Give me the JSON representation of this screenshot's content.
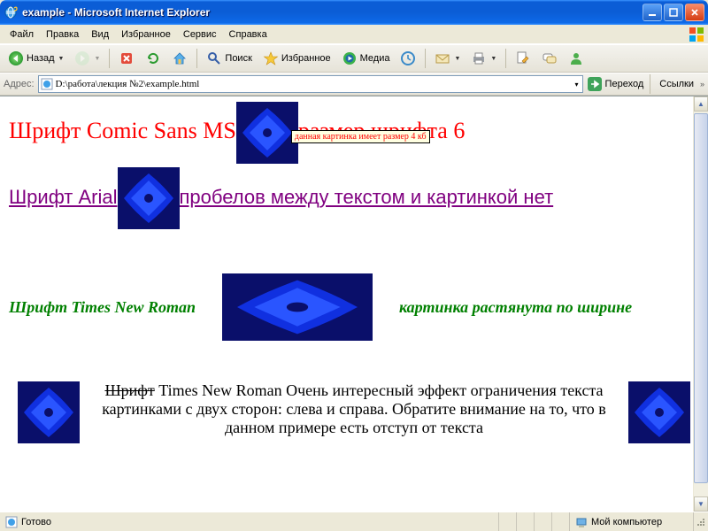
{
  "window": {
    "title": "example - Microsoft Internet Explorer"
  },
  "menu": {
    "items": [
      "Файл",
      "Правка",
      "Вид",
      "Избранное",
      "Сервис",
      "Справка"
    ]
  },
  "toolbar": {
    "back": "Назад",
    "search": "Поиск",
    "favorites": "Избранное",
    "media": "Медиа"
  },
  "address": {
    "label": "Адрес:",
    "value": "D:\\работа\\лекция №2\\example.html",
    "go": "Переход",
    "links": "Ссылки"
  },
  "page": {
    "tooltip": "данная картинка имеет размер 4 кб",
    "line1a": "Шрифт Comic Sans MS",
    "line1b": "размер шрифта 6",
    "line2a": "Шрифт Arial",
    "line2b": "пробелов между текстом и картинкой нет",
    "line3a": "Шрифт Times New Roman",
    "line3b": "картинка растянута по ширине",
    "para4_strike": "Шрифт",
    "para4_rest": " Times New Roman Очень интересный эффект ограничения текста картинками с двух сторон: слева и справа. Обратите внимание на то, что в данном примере есть отступ от текста"
  },
  "status": {
    "ready": "Готово",
    "zone": "Мой компьютер"
  }
}
